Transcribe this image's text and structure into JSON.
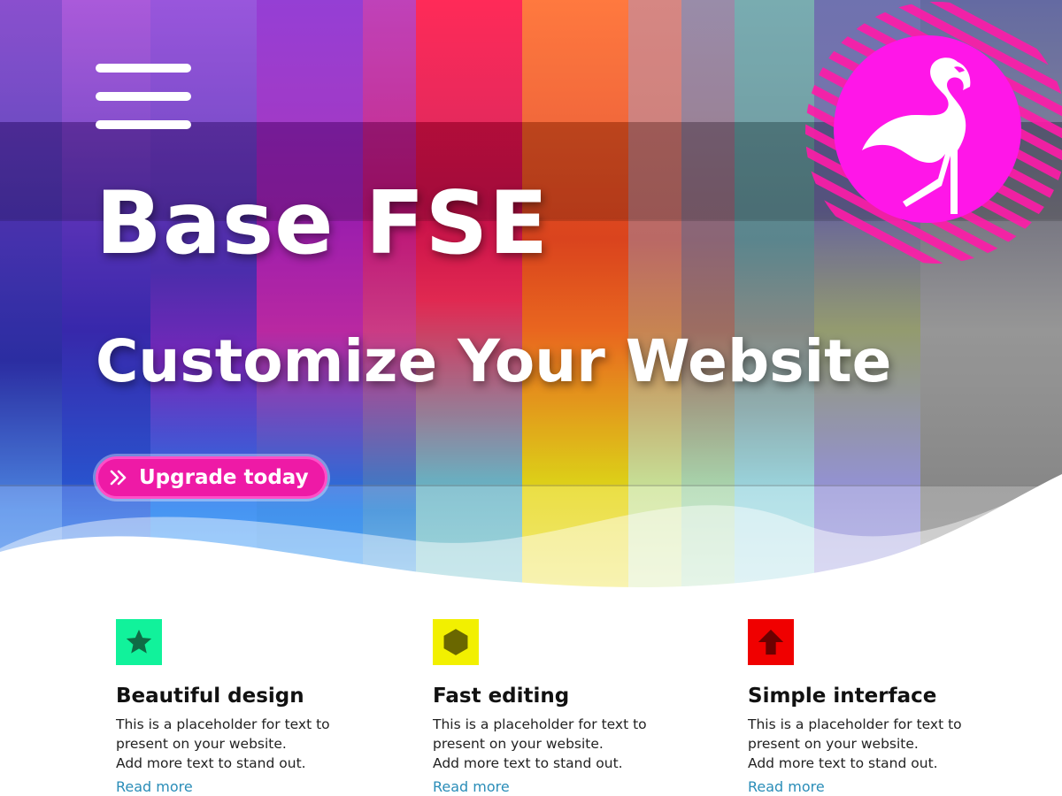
{
  "hero": {
    "title": "Base FSE",
    "subtitle": "Customize Your Website",
    "cta_label": "Upgrade today",
    "icons": {
      "menu": "hamburger-menu-icon",
      "logo": "flamingo-logo-icon",
      "cta": "double-chevron-right-icon"
    }
  },
  "features": [
    {
      "title": "Beautiful design",
      "lines": [
        "This is a placeholder for text to",
        "present on your website.",
        "Add more text to stand out."
      ],
      "link": "Read more",
      "icon": "star-icon",
      "icon_bg": "#11f29b",
      "icon_fg": "#0f6b45"
    },
    {
      "title": "Fast editing",
      "lines": [
        "This is a placeholder for text to",
        "present on your website.",
        "Add more text to stand out."
      ],
      "link": "Read more",
      "icon": "hexagon-icon",
      "icon_bg": "#f2f000",
      "icon_fg": "#6a6700"
    },
    {
      "title": "Simple interface",
      "lines": [
        "This is a placeholder for text to",
        "present on your website.",
        "Add more text to stand out."
      ],
      "link": "Read more",
      "icon": "arrow-up-icon",
      "icon_bg": "#f00000",
      "icon_fg": "#6b0000"
    }
  ],
  "colors": {
    "accent": "#ee1aa6",
    "logo": "#ff16e8",
    "link": "#2a8db8"
  }
}
